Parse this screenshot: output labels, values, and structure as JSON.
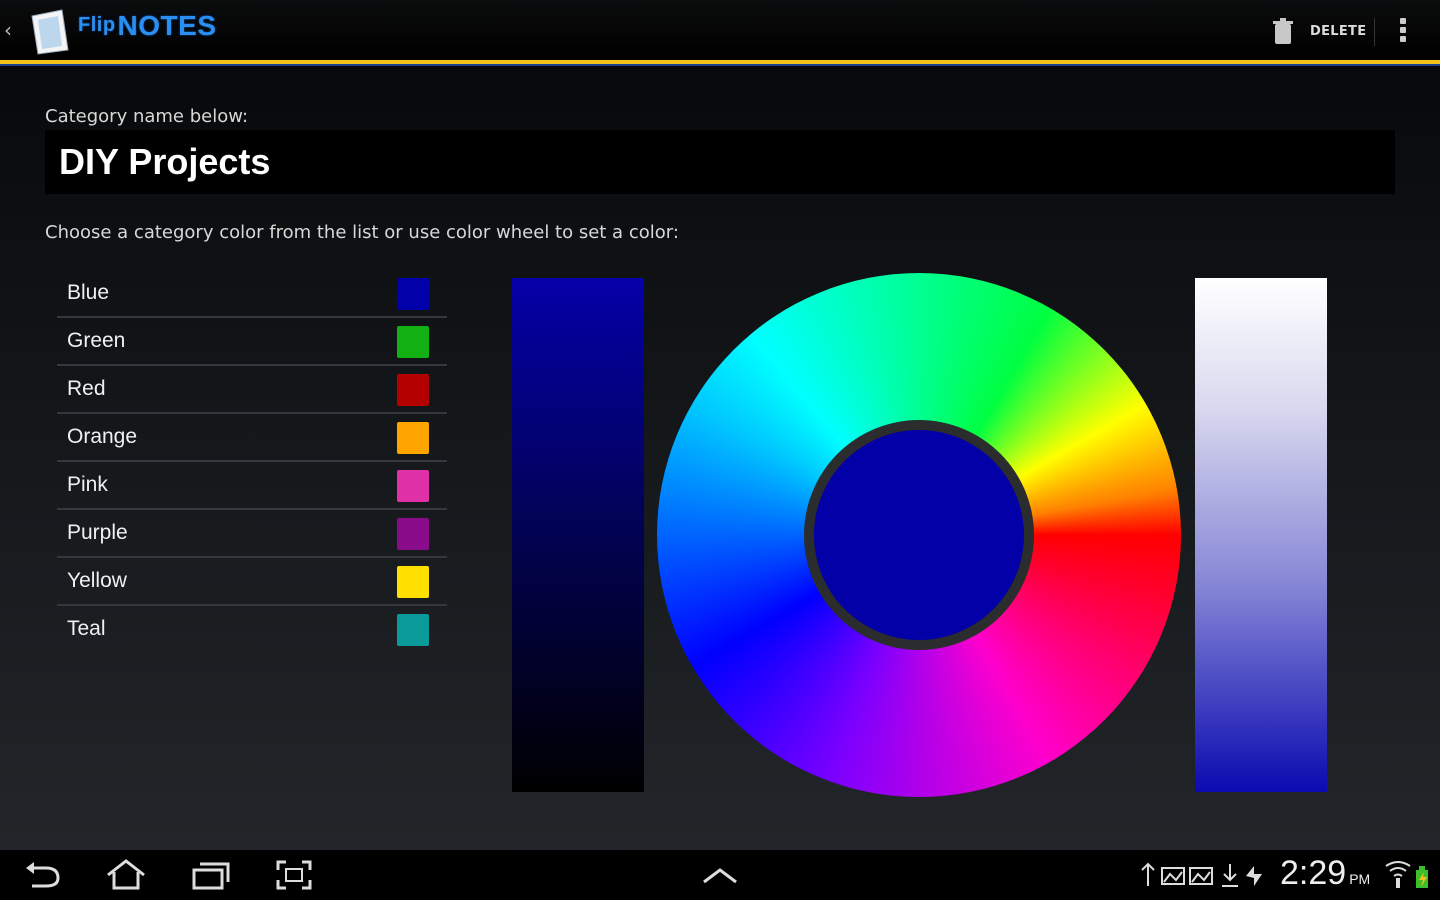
{
  "app": {
    "logo_prefix": "Flip",
    "logo_text": "NOTES",
    "delete_label": "DELETE",
    "accent_color": "#f2c21b",
    "brand_color": "#2a8ff0"
  },
  "form": {
    "name_label": "Category name below:",
    "name_value": "DIY Projects",
    "color_label": "Choose a category color from the list or use color wheel to set a color:"
  },
  "colors": [
    {
      "name": "Blue",
      "hex": "#0200a8"
    },
    {
      "name": "Green",
      "hex": "#12b012"
    },
    {
      "name": "Red",
      "hex": "#b40000"
    },
    {
      "name": "Orange",
      "hex": "#ffa500"
    },
    {
      "name": "Pink",
      "hex": "#e030a8"
    },
    {
      "name": "Purple",
      "hex": "#8a0c8a"
    },
    {
      "name": "Yellow",
      "hex": "#ffe000"
    },
    {
      "name": "Teal",
      "hex": "#0a9a9a"
    }
  ],
  "picker": {
    "selected_color": "#0200a6"
  },
  "statusbar": {
    "time": "2:29",
    "ampm": "PM"
  },
  "icons": {
    "back": "back-icon",
    "home": "home-icon",
    "recents": "recent-apps-icon",
    "screenshot": "screenshot-icon",
    "up": "chevron-up-icon"
  }
}
